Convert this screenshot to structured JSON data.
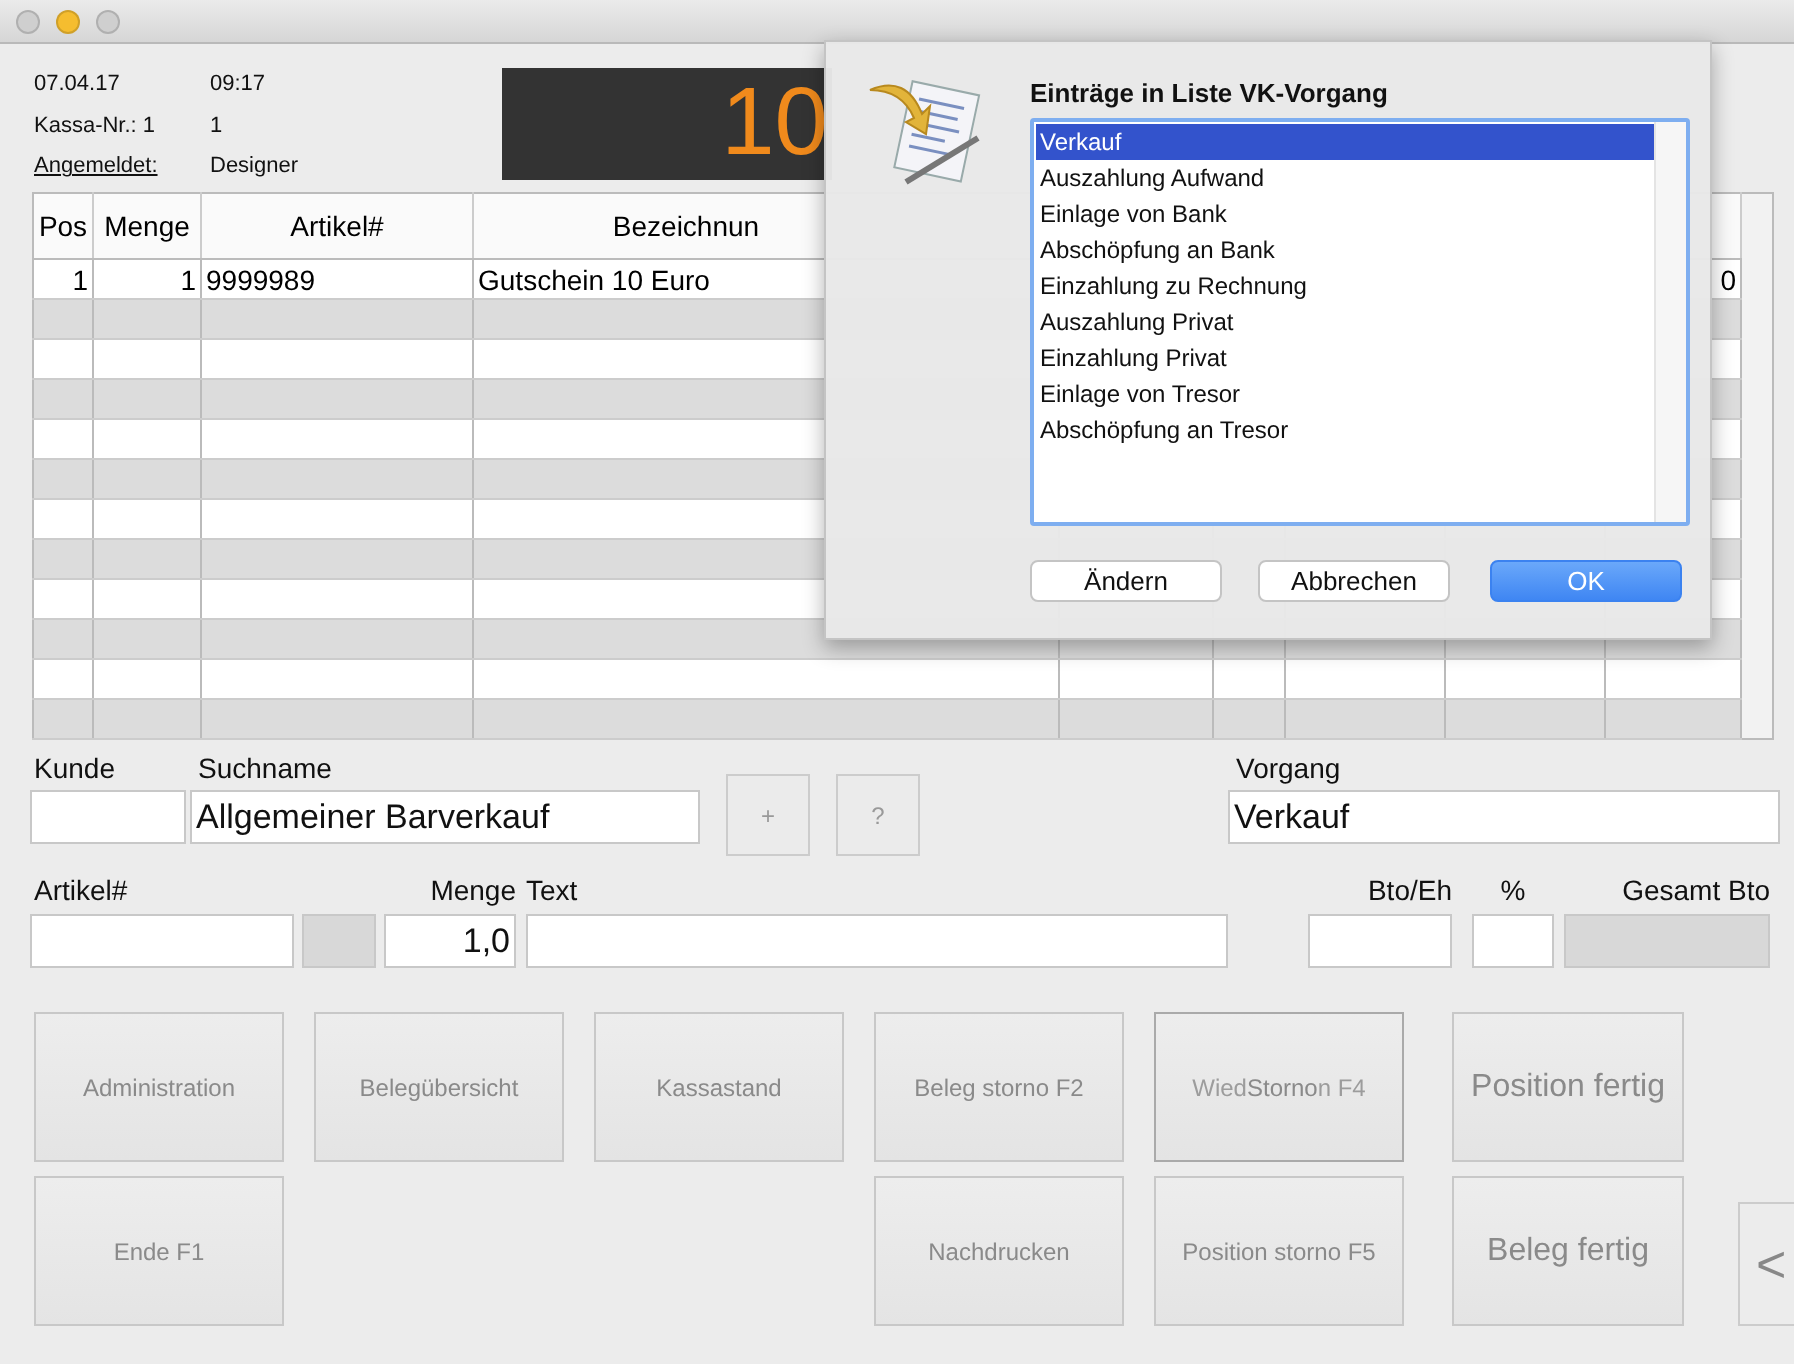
{
  "window": {
    "controls": [
      {
        "kind": "close"
      },
      {
        "kind": "minimize"
      },
      {
        "kind": "zoom"
      }
    ]
  },
  "info": [
    {
      "label": "07.04.17",
      "value": "09:17",
      "underlined": false
    },
    {
      "label": "Kassa-Nr.: 1",
      "value": "1",
      "underlined": false
    },
    {
      "label": "Angemeldet:",
      "value": "Designer",
      "underlined": true
    }
  ],
  "amount_display": "10",
  "table": {
    "columns": [
      "Pos",
      "Menge",
      "Artikel#",
      "Bezeichnun"
    ],
    "rows": [
      [
        "1",
        "1",
        "9999989",
        "Gutschein 10 Euro",
        "0"
      ]
    ]
  },
  "customer": {
    "kunde_label": "Kunde",
    "suchname_label": "Suchname",
    "suchname_value": "Allgemeiner Barverkauf",
    "plus": "+",
    "help": "?",
    "vorgang_label": "Vorgang",
    "vorgang_value": "Verkauf"
  },
  "entry": {
    "artikel_label": "Artikel#",
    "menge_label": "Menge",
    "menge_value": "1,0",
    "text_label": "Text",
    "bto_label": "Bto/Eh",
    "percent_label": "%",
    "gesamt_label": "Gesamt Bto"
  },
  "buttons": [
    {
      "label": "Administration",
      "kind": "normal"
    },
    {
      "label": "Belegübersicht",
      "kind": "normal"
    },
    {
      "label": "Kassastand",
      "kind": "normal"
    },
    {
      "label": "Beleg storno F2",
      "kind": "normal"
    },
    {
      "label": "Storno",
      "kind": "overlapped",
      "covered_start": "Wied",
      "covered_end": "n F4"
    },
    {
      "label": "Position fertig",
      "kind": "large"
    },
    {
      "label": "Ende F1",
      "kind": "normal"
    },
    {
      "label": "Nachdrucken",
      "kind": "normal"
    },
    {
      "label": "Position storno F5",
      "kind": "normal"
    },
    {
      "label": "Beleg fertig",
      "kind": "large"
    },
    {
      "label": "<",
      "kind": "edge"
    }
  ],
  "dialog": {
    "title": "Einträge in Liste VK-Vorgang",
    "items": [
      {
        "label": "Verkauf",
        "selected": true
      },
      {
        "label": "Auszahlung Aufwand",
        "selected": false
      },
      {
        "label": "Einlage von Bank",
        "selected": false
      },
      {
        "label": "Abschöpfung an Bank",
        "selected": false
      },
      {
        "label": "Einzahlung zu Rechnung",
        "selected": false
      },
      {
        "label": "Auszahlung Privat",
        "selected": false
      },
      {
        "label": "Einzahlung Privat",
        "selected": false
      },
      {
        "label": "Einlage von Tresor",
        "selected": false
      },
      {
        "label": "Abschöpfung an Tresor",
        "selected": false
      }
    ],
    "buttons": [
      {
        "label": "Ändern",
        "default": false
      },
      {
        "label": "Abbrechen",
        "default": false
      },
      {
        "label": "OK",
        "default": true
      }
    ]
  }
}
